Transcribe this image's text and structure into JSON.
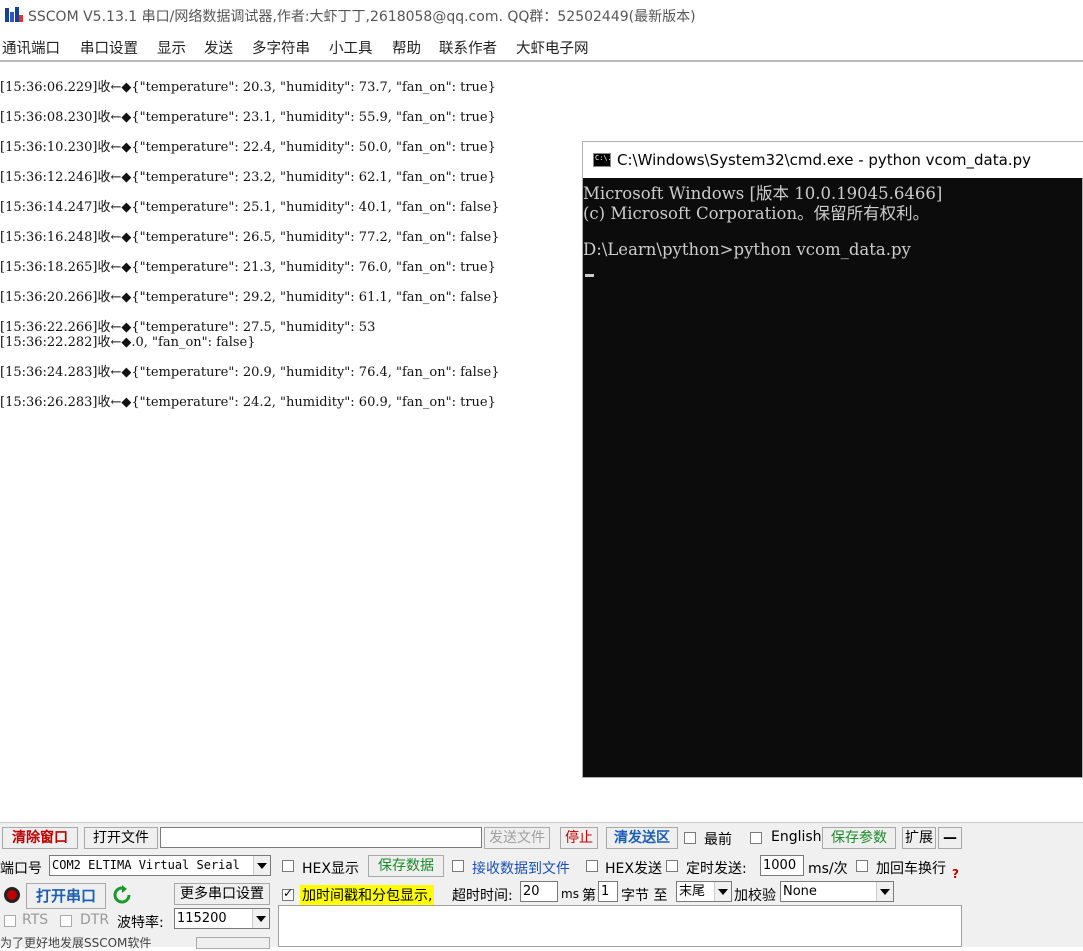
{
  "app": {
    "title": "SSCOM V5.13.1 串口/网络数据调试器,作者:大虾丁丁,2618058@qq.com. QQ群：52502449(最新版本)"
  },
  "menu": [
    "通讯端口",
    "串口设置",
    "显示",
    "发送",
    "多字符串",
    "小工具",
    "帮助",
    "联系作者",
    "大虾电子网"
  ],
  "log": [
    "[15:36:06.229]收←◆{\"temperature\": 20.3, \"humidity\": 73.7, \"fan_on\": true}",
    "[15:36:08.230]收←◆{\"temperature\": 23.1, \"humidity\": 55.9, \"fan_on\": true}",
    "[15:36:10.230]收←◆{\"temperature\": 22.4, \"humidity\": 50.0, \"fan_on\": true}",
    "[15:36:12.246]收←◆{\"temperature\": 23.2, \"humidity\": 62.1, \"fan_on\": true}",
    "[15:36:14.247]收←◆{\"temperature\": 25.1, \"humidity\": 40.1, \"fan_on\": false}",
    "[15:36:16.248]收←◆{\"temperature\": 26.5, \"humidity\": 77.2, \"fan_on\": false}",
    "[15:36:18.265]收←◆{\"temperature\": 21.3, \"humidity\": 76.0, \"fan_on\": true}",
    "[15:36:20.266]收←◆{\"temperature\": 29.2, \"humidity\": 61.1, \"fan_on\": false}",
    "[15:36:22.266]收←◆{\"temperature\": 27.5, \"humidity\": 53",
    "[15:36:22.282]收←◆.0, \"fan_on\": false}",
    "[15:36:24.283]收←◆{\"temperature\": 20.9, \"humidity\": 76.4, \"fan_on\": false}",
    "[15:36:26.283]收←◆{\"temperature\": 24.2, \"humidity\": 60.9, \"fan_on\": true}"
  ],
  "cmd": {
    "icon_text": "C:\\.",
    "title": "C:\\Windows\\System32\\cmd.exe - python  vcom_data.py",
    "lines": [
      "Microsoft Windows [版本 10.0.19045.6466]",
      "(c) Microsoft Corporation。保留所有权利。",
      "",
      "D:\\Learn\\python>python vcom_data.py"
    ]
  },
  "bottom": {
    "clear_window": "清除窗口",
    "open_file": "打开文件",
    "send_file": "发送文件",
    "stop": "停止",
    "clear_send": "清发送区",
    "topmost": "最前",
    "english": "English",
    "save_params": "保存参数",
    "expand": "扩展",
    "collapse": "—",
    "port_label": "端口号",
    "port_value": "COM2 ELTIMA Virtual Serial",
    "hex_display": "HEX显示",
    "save_data": "保存数据",
    "recv_to_file": "接收数据到文件",
    "hex_send": "HEX发送",
    "timed_send": "定时发送:",
    "timed_interval": "1000",
    "interval_unit": "ms/次",
    "add_crlf": "加回车换行",
    "open_port": "打开串口",
    "more_settings": "更多串口设置",
    "timestamp_split": "加时间戳和分包显示,",
    "timeout_label": "超时时间:",
    "timeout_value": "20",
    "timeout_unit": "ms",
    "byte_prefix": "第",
    "byte_value": "1",
    "byte_mid": "字节 至",
    "byte_end": "末尾",
    "checksum_label": "加校验",
    "checksum_value": "None",
    "rts": "RTS",
    "dtr": "DTR",
    "baud_label": "波特率:",
    "baud_value": "115200",
    "footer_text": "为了更好地发展SSCOM软件"
  }
}
